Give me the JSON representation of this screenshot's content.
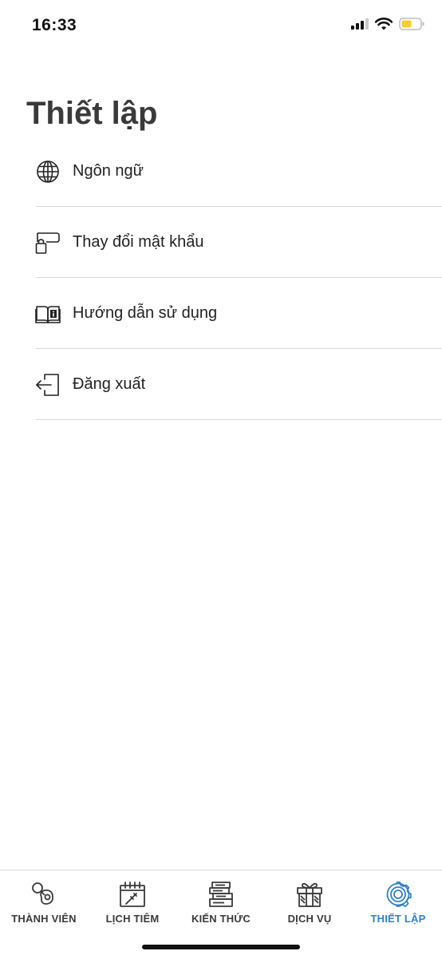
{
  "status_bar": {
    "time": "16:33",
    "icons": [
      "cellular-signal-icon",
      "wifi-icon",
      "battery-icon"
    ]
  },
  "page": {
    "title": "Thiết lập"
  },
  "settings": {
    "items": [
      {
        "label": "Ngôn ngữ",
        "icon": "globe-icon"
      },
      {
        "label": "Thay đổi mật khẩu",
        "icon": "password-change-icon"
      },
      {
        "label": "Hướng dẫn sử dụng",
        "icon": "book-info-icon"
      },
      {
        "label": "Đăng xuất",
        "icon": "logout-icon"
      }
    ]
  },
  "tab_bar": {
    "active_color": "#2f80c8",
    "inactive_color": "#3a3a3a",
    "tabs": [
      {
        "label": "THÀNH VIÊN",
        "icon": "pacifier-icon",
        "active": false
      },
      {
        "label": "LỊCH TIÊM",
        "icon": "calendar-syringe-icon",
        "active": false
      },
      {
        "label": "KIẾN THỨC",
        "icon": "books-icon",
        "active": false
      },
      {
        "label": "DỊCH VỤ",
        "icon": "gift-icon",
        "active": false
      },
      {
        "label": "THIẾT LẬP",
        "icon": "gear-icon",
        "active": true
      }
    ]
  }
}
